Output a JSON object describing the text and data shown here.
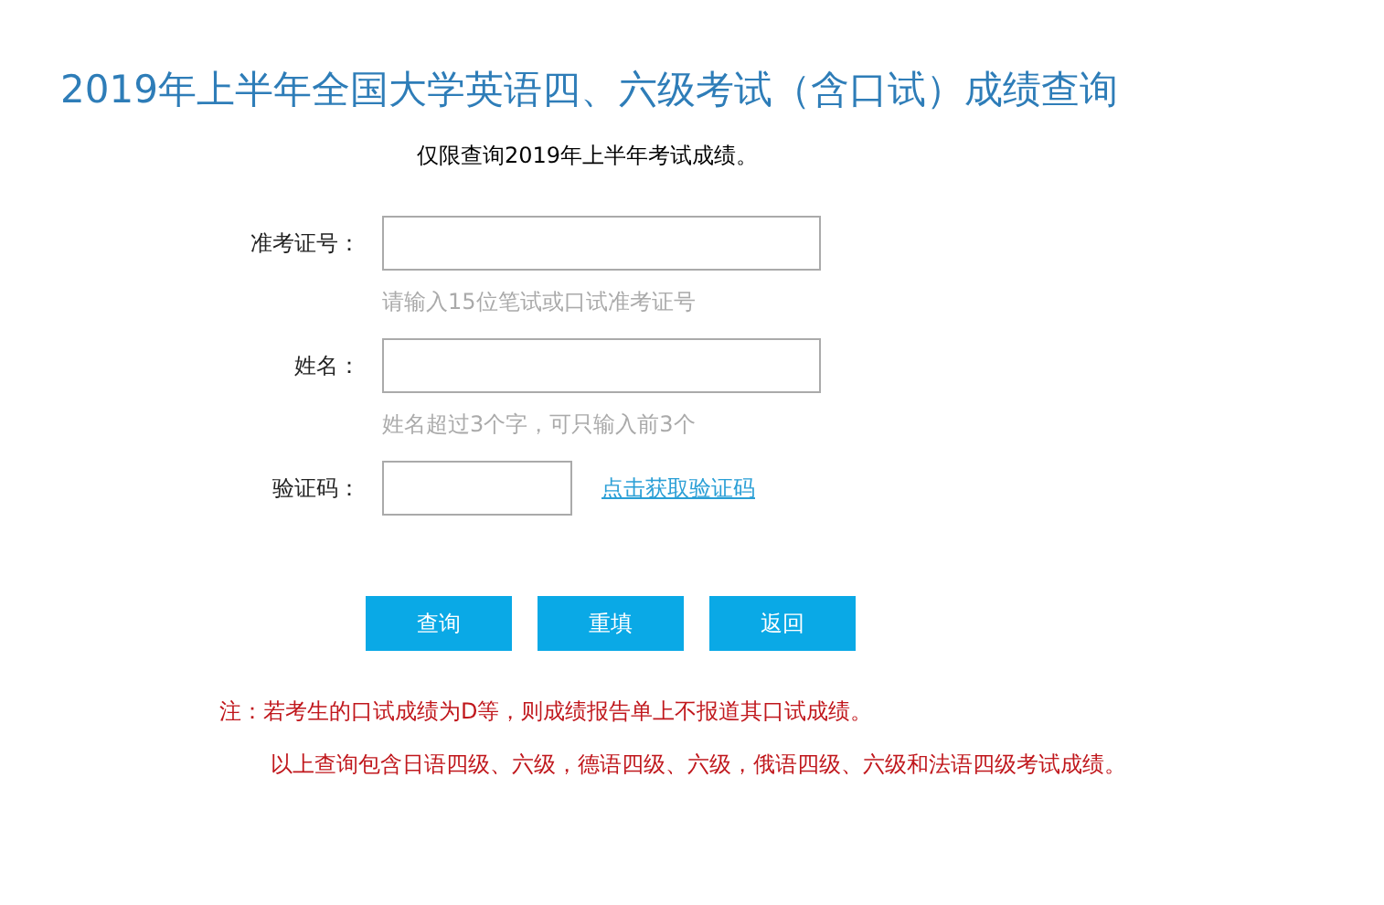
{
  "title": "2019年上半年全国大学英语四、六级考试（含口试）成绩查询",
  "subtitle": "仅限查询2019年上半年考试成绩。",
  "fields": [
    {
      "kind": "text",
      "label": "准考证号：",
      "hint": "请输入15位笔试或口试准考证号"
    },
    {
      "kind": "text",
      "label": "姓名：",
      "hint": "姓名超过3个字，可只输入前3个"
    },
    {
      "kind": "captcha",
      "label": "验证码：",
      "link": "点击获取验证码"
    }
  ],
  "buttons": [
    "查询",
    "重填",
    "返回"
  ],
  "notes": [
    "注：若考生的口试成绩为D等，则成绩报告单上不报道其口试成绩。",
    "以上查询包含日语四级、六级，德语四级、六级，俄语四级、六级和法语四级考试成绩。"
  ]
}
